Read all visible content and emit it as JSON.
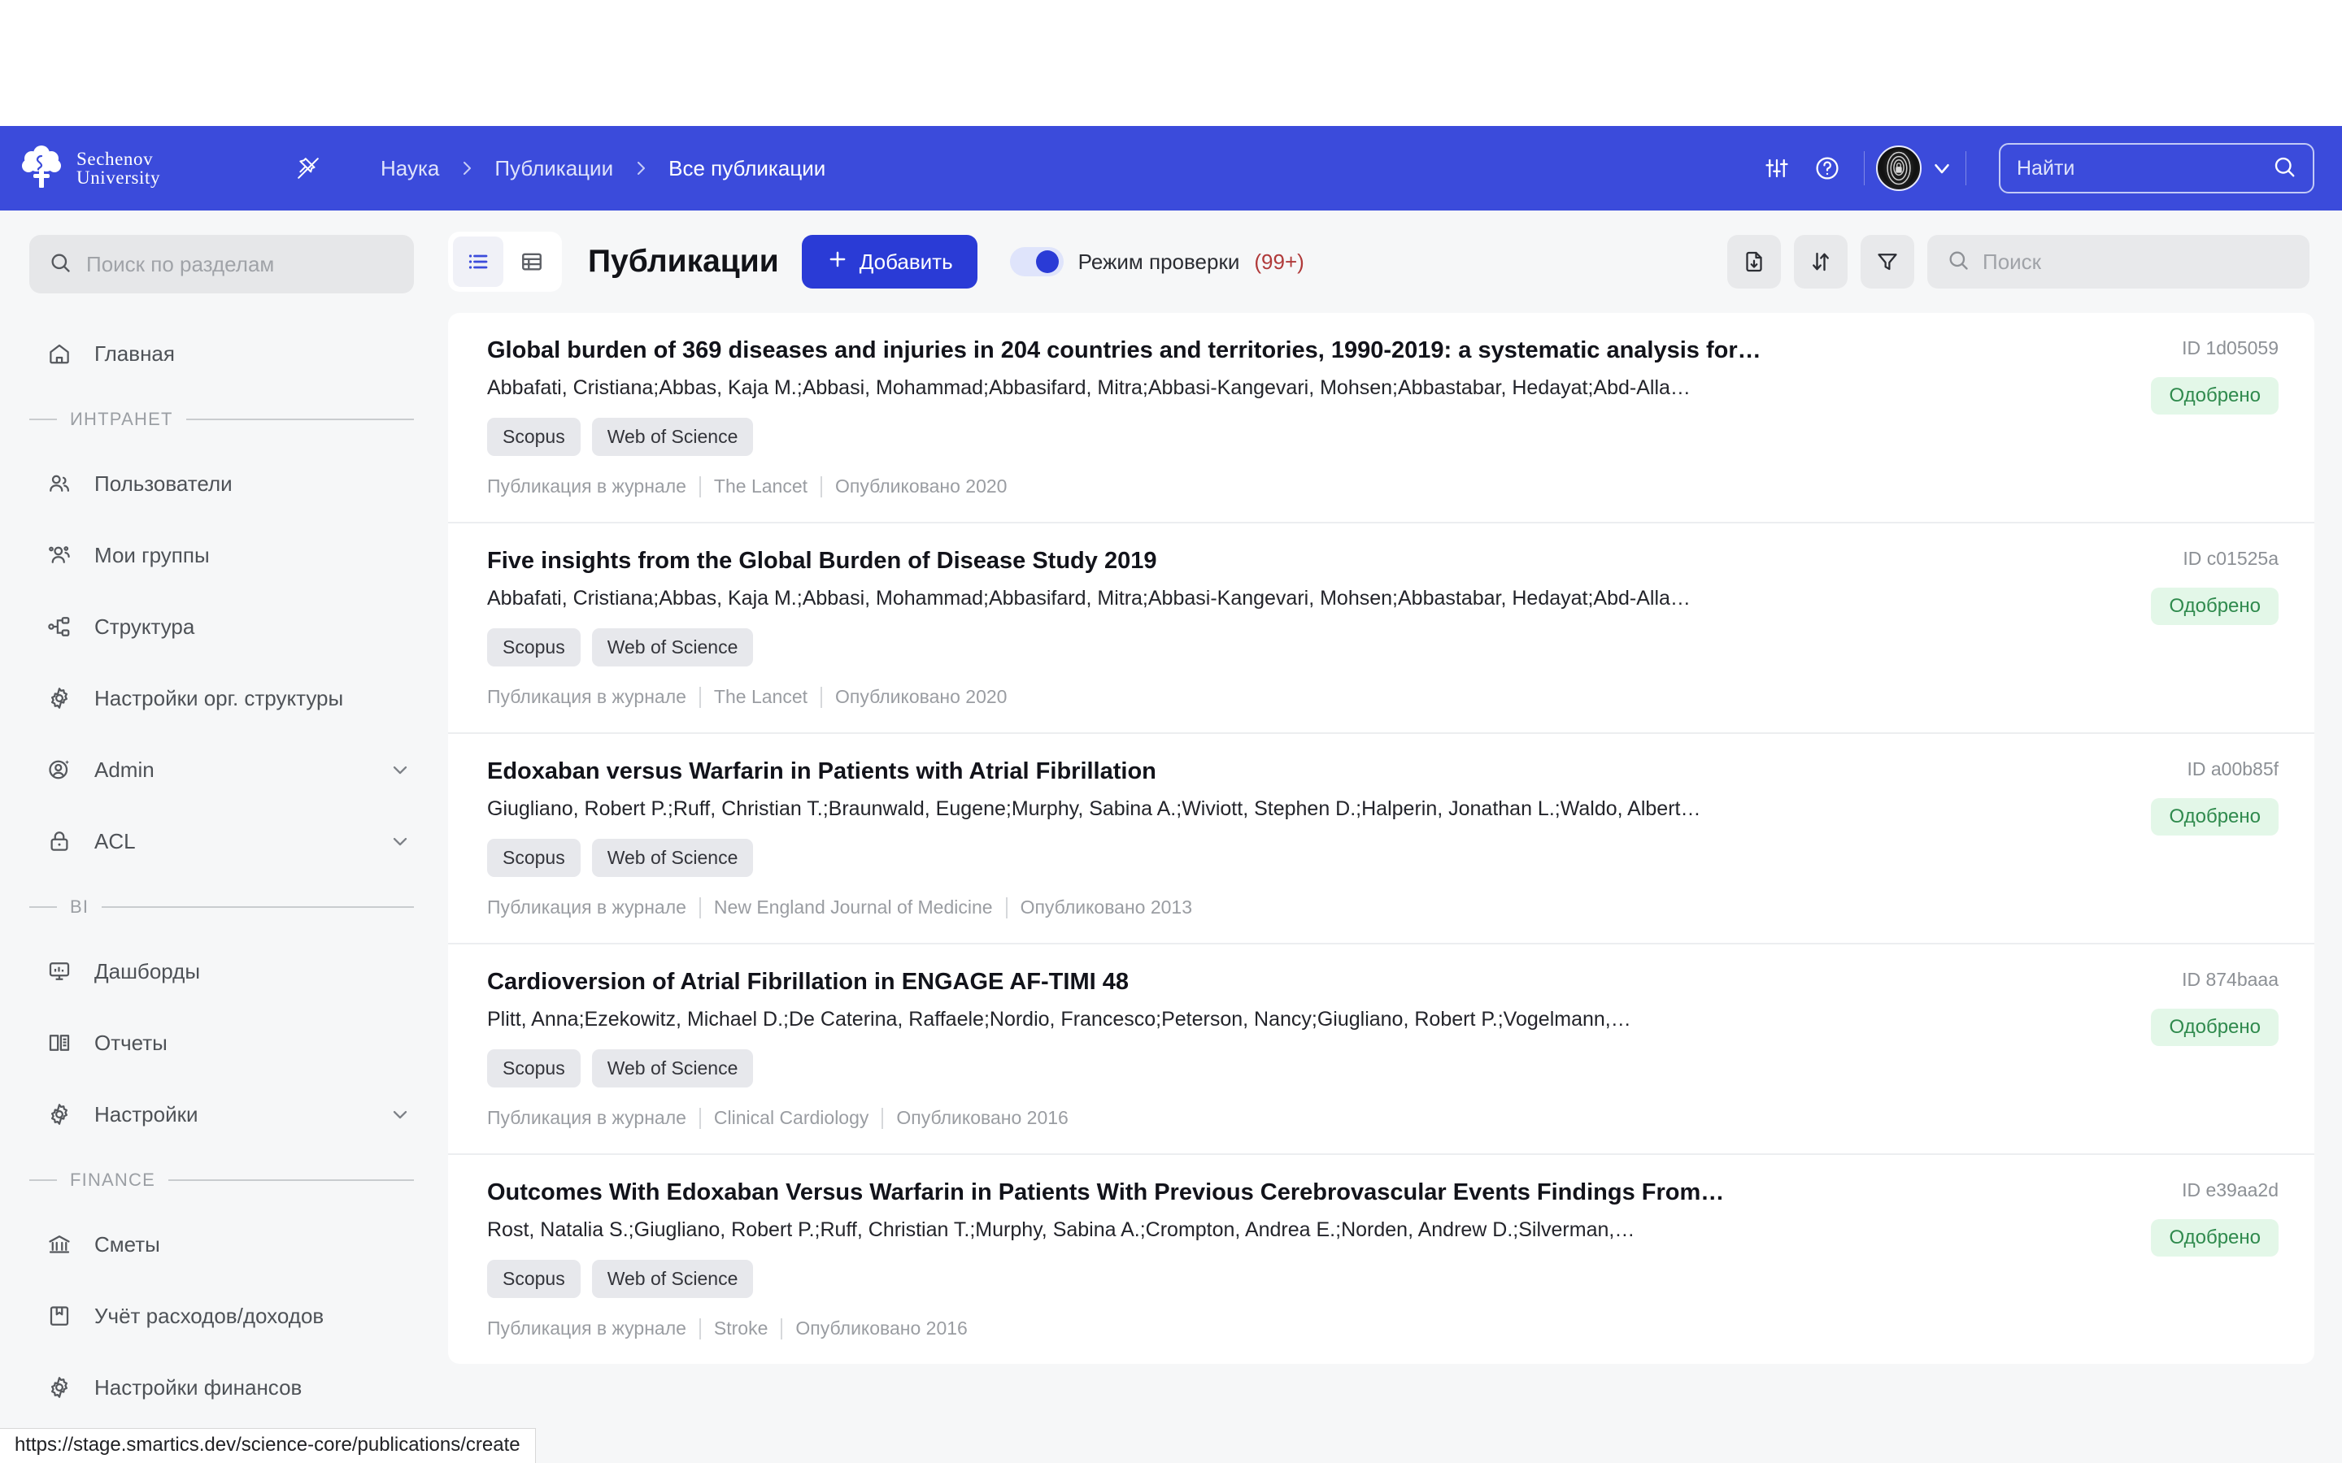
{
  "topbar": {
    "logo_line1": "Sechenov",
    "logo_line2": "University",
    "pin_icon": "pin-off-icon",
    "breadcrumb": [
      {
        "label": "Наука"
      },
      {
        "label": "Публикации"
      },
      {
        "label": "Все публикации"
      }
    ],
    "settings_icon": "sliders-icon",
    "help_icon": "help-circle-icon",
    "avatar_icon": "fingerprint-avatar",
    "chevron_icon": "chevron-down-icon",
    "search": {
      "value": "",
      "placeholder": "Найти",
      "icon": "search-icon"
    }
  },
  "sidebar": {
    "search": {
      "value": "",
      "placeholder": "Поиск по разделам",
      "icon": "search-icon"
    },
    "items": [
      {
        "label": "Главная",
        "icon": "home-icon",
        "expandable": false
      },
      {
        "section": "ИНТРАНЕТ"
      },
      {
        "label": "Пользователи",
        "icon": "users-icon",
        "expandable": false
      },
      {
        "label": "Мои группы",
        "icon": "user-group-icon",
        "expandable": false
      },
      {
        "label": "Структура",
        "icon": "org-tree-icon",
        "expandable": false
      },
      {
        "label": "Настройки орг. структуры",
        "icon": "gear-icon",
        "expandable": false
      },
      {
        "label": "Admin",
        "icon": "admin-user-icon",
        "expandable": true
      },
      {
        "label": "ACL",
        "icon": "lock-icon",
        "expandable": true
      },
      {
        "section": "BI"
      },
      {
        "label": "Дашборды",
        "icon": "dashboard-icon",
        "expandable": false
      },
      {
        "label": "Отчеты",
        "icon": "report-book-icon",
        "expandable": false
      },
      {
        "label": "Настройки",
        "icon": "gear-icon",
        "expandable": true
      },
      {
        "section": "FINANCE"
      },
      {
        "label": "Сметы",
        "icon": "bank-icon",
        "expandable": false
      },
      {
        "label": "Учёт расходов/доходов",
        "icon": "ledger-book-icon",
        "expandable": false
      },
      {
        "label": "Настройки финансов",
        "icon": "gear-icon",
        "expandable": false
      }
    ]
  },
  "toolbar": {
    "view_list_icon": "list-view-icon",
    "view_table_icon": "table-view-icon",
    "title": "Публикации",
    "add_label": "Добавить",
    "add_icon": "plus-icon",
    "check_mode_label": "Режим проверки",
    "check_mode_count": "(99+)",
    "check_mode_on": true,
    "export_icon": "file-download-icon",
    "sort_icon": "sort-icon",
    "filter_icon": "filter-icon",
    "search": {
      "value": "",
      "placeholder": "Поиск",
      "icon": "search-icon"
    }
  },
  "publications": [
    {
      "title": "Global burden of 369 diseases and injuries in 204 countries and territories, 1990-2019: a systematic analysis for…",
      "authors": "Abbafati, Cristiana;Abbas, Kaja M.;Abbasi, Mohammad;Abbasifard, Mitra;Abbasi-Kangevari, Mohsen;Abbastabar, Hedayat;Abd-Alla…",
      "chips": [
        "Scopus",
        "Web of Science"
      ],
      "type": "Публикация в журнале",
      "journal": "The Lancet",
      "published": "Опубликовано 2020",
      "id": "ID 1d05059",
      "status": "Одобрено"
    },
    {
      "title": "Five insights from the Global Burden of Disease Study 2019",
      "authors": "Abbafati, Cristiana;Abbas, Kaja M.;Abbasi, Mohammad;Abbasifard, Mitra;Abbasi-Kangevari, Mohsen;Abbastabar, Hedayat;Abd-Alla…",
      "chips": [
        "Scopus",
        "Web of Science"
      ],
      "type": "Публикация в журнале",
      "journal": "The Lancet",
      "published": "Опубликовано 2020",
      "id": "ID c01525a",
      "status": "Одобрено"
    },
    {
      "title": "Edoxaban versus Warfarin in Patients with Atrial Fibrillation",
      "authors": "Giugliano, Robert P.;Ruff, Christian T.;Braunwald, Eugene;Murphy, Sabina A.;Wiviott, Stephen D.;Halperin, Jonathan L.;Waldo, Albert…",
      "chips": [
        "Scopus",
        "Web of Science"
      ],
      "type": "Публикация в журнале",
      "journal": "New England Journal of Medicine",
      "published": "Опубликовано 2013",
      "id": "ID a00b85f",
      "status": "Одобрено"
    },
    {
      "title": "Cardioversion of Atrial Fibrillation in ENGAGE AF-TIMI 48",
      "authors": "Plitt, Anna;Ezekowitz, Michael D.;De Caterina, Raffaele;Nordio, Francesco;Peterson, Nancy;Giugliano, Robert P.;Vogelmann,…",
      "chips": [
        "Scopus",
        "Web of Science"
      ],
      "type": "Публикация в журнале",
      "journal": "Clinical Cardiology",
      "published": "Опубликовано 2016",
      "id": "ID 874baaa",
      "status": "Одобрено"
    },
    {
      "title": "Outcomes With Edoxaban Versus Warfarin in Patients With Previous Cerebrovascular Events Findings From…",
      "authors": "Rost, Natalia S.;Giugliano, Robert P.;Ruff, Christian T.;Murphy, Sabina A.;Crompton, Andrea E.;Norden, Andrew D.;Silverman,…",
      "chips": [
        "Scopus",
        "Web of Science"
      ],
      "type": "Публикация в журнале",
      "journal": "Stroke",
      "published": "Опубликовано 2016",
      "id": "ID e39aa2d",
      "status": "Одобрено"
    }
  ],
  "statusbar": {
    "url": "https://stage.smartics.dev/science-core/publications/create"
  },
  "colors": {
    "brand_blue": "#3b4bdb",
    "accent_blue": "#2a3bd6",
    "page_bg": "#f6f7f8",
    "status_green_bg": "#e3f7e8",
    "status_green_text": "#2f8a4d",
    "count_red": "#b03a3a"
  }
}
